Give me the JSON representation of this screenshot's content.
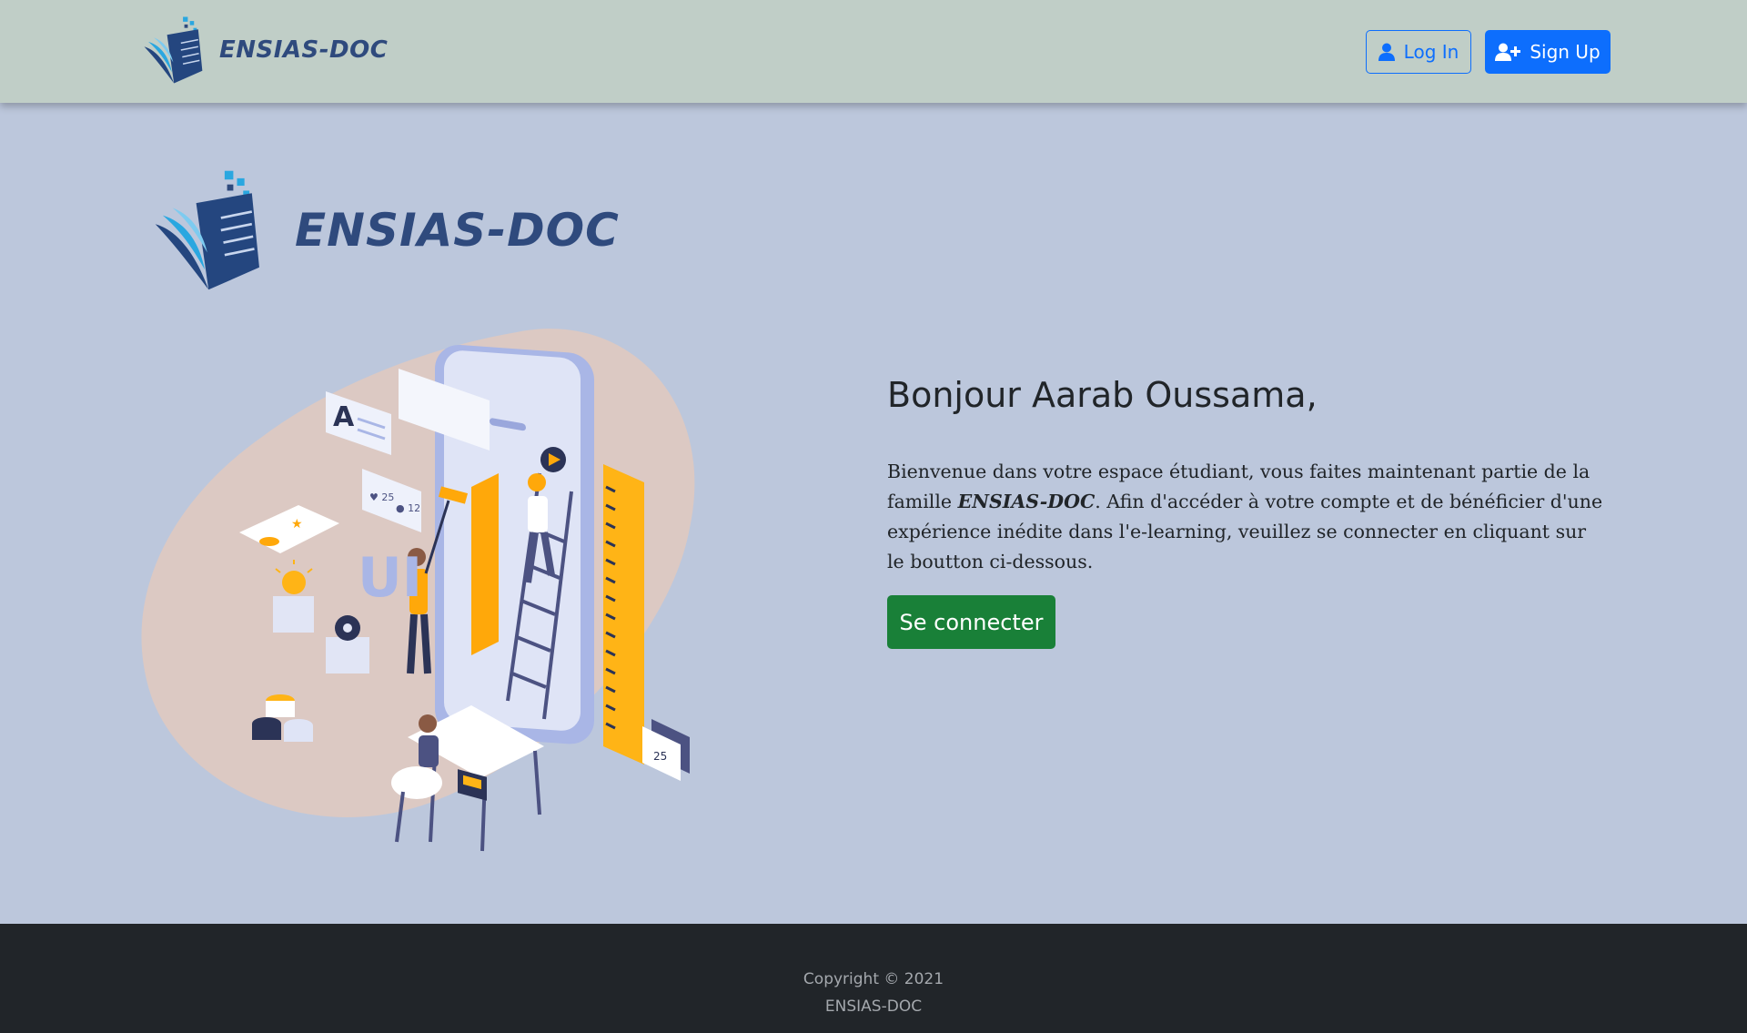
{
  "navbar": {
    "brand": "ENSIAS-DOC",
    "login_label": "Log In",
    "signup_label": "Sign Up",
    "login_icon": "user-icon",
    "signup_icon": "user-plus-icon"
  },
  "hero": {
    "brand": "ENSIAS-DOC",
    "greeting": "Bonjour Aarab Oussama,",
    "paragraph_before": "Bienvenue dans votre espace étudiant, vous faites maintenant partie de la famille ",
    "paragraph_brand": "ENSIAS-DOC",
    "paragraph_after": ". Afin d'accéder à votre compte et de bénéficier d'une expérience inédite dans l'e-learning, veuillez se connecter en cliquant sur le boutton ci-dessous.",
    "button_label": "Se connecter"
  },
  "footer": {
    "copyright": "Copyright © 2021",
    "brand": "ENSIAS-DOC"
  },
  "colors": {
    "navbar_bg": "#c0cec7",
    "page_bg": "#bcc7dc",
    "primary": "#0d6efd",
    "success": "#198038",
    "footer_bg": "#212529",
    "brand_text": "#2f4a7d"
  }
}
